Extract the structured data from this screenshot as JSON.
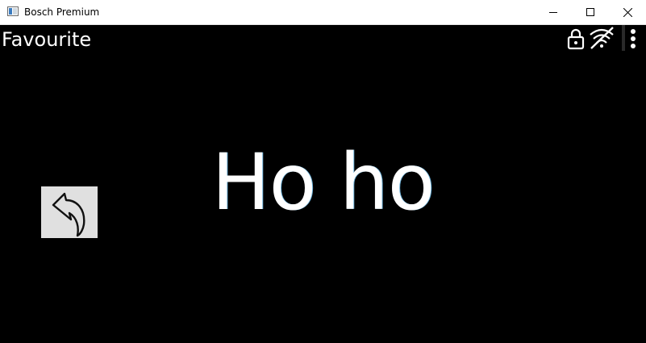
{
  "window": {
    "title": "Bosch Premium",
    "icons": {
      "app": "app-window-icon",
      "minimize": "minimize-icon",
      "maximize": "maximize-icon",
      "close": "close-icon"
    }
  },
  "header": {
    "title": "Favourite",
    "icons": [
      "lock-icon",
      "wifi-off-icon",
      "more-vert-icon"
    ]
  },
  "main": {
    "text": "Ho ho"
  },
  "back_button": {
    "icon": "undo-arrow-icon"
  },
  "colors": {
    "background": "#000000",
    "text": "#ffffff",
    "back_button_bg": "#e0e0e0"
  }
}
